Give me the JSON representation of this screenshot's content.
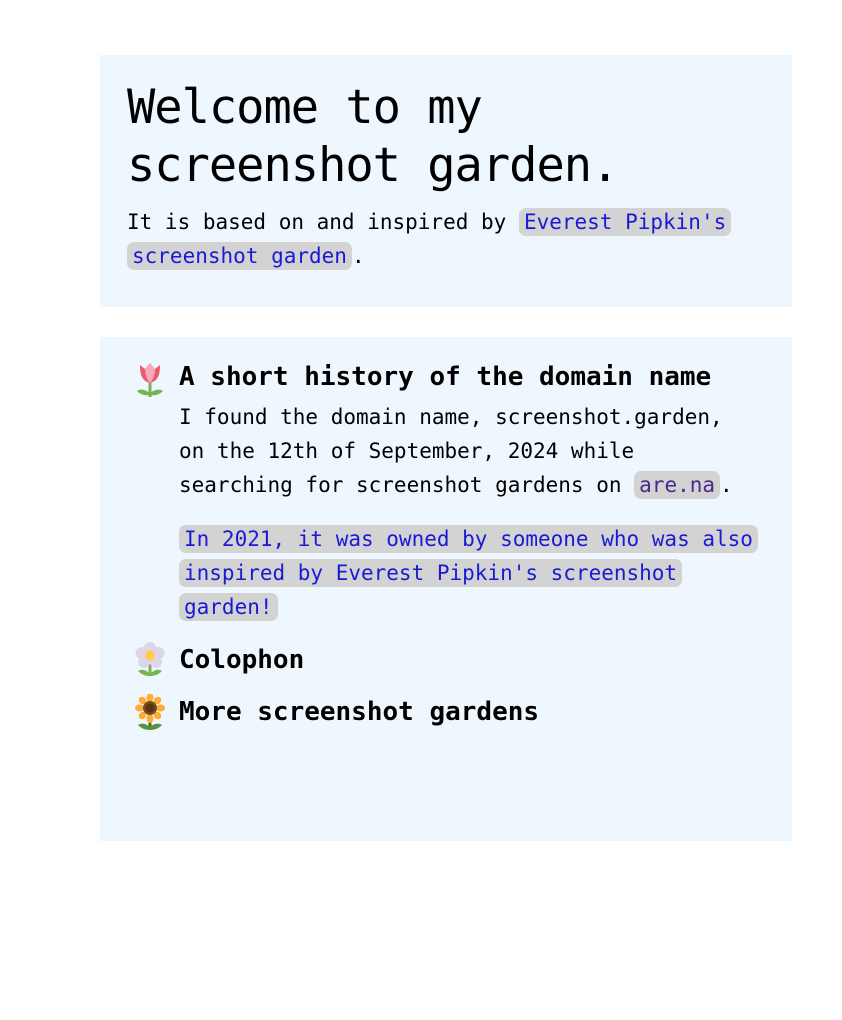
{
  "intro": {
    "heading": "Welcome to my screenshot garden.",
    "text_before": "It is based on and inspired by ",
    "link": "Everest Pipkin's screenshot garden",
    "text_after": "."
  },
  "sections": [
    {
      "icon": "tulip-icon",
      "title": "A short history of the domain name",
      "paragraph1_text": "I found the domain name, screenshot.garden, on the 12th of September, 2024 while searching for screenshot gardens on ",
      "paragraph1_link": "are.na",
      "paragraph1_after": ".",
      "paragraph2_link": "In 2021, it was owned by someone who was also inspired by Everest Pipkin's screenshot garden!"
    },
    {
      "icon": "blossom-icon",
      "title": "Colophon"
    },
    {
      "icon": "sunflower-icon",
      "title": "More screenshot gardens"
    }
  ],
  "colors": {
    "panel_bg": "#eff7fe",
    "link_bg": "#d3d3d3",
    "link": "#1a1ad6",
    "visited_link": "#4a2a8a"
  }
}
